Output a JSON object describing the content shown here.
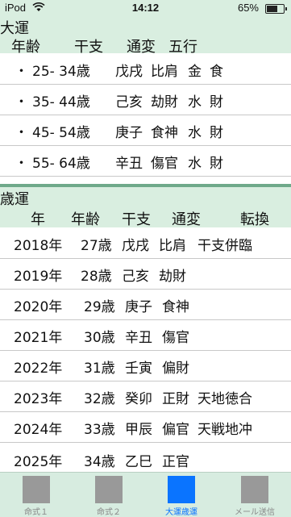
{
  "status": {
    "carrier": "iPod",
    "time": "14:12",
    "battery": "65%"
  },
  "daiun": {
    "title": "大運",
    "headers": [
      "年齢",
      "干支",
      "通変",
      "五行"
    ],
    "rows": [
      {
        "bullet": "・",
        "age": "25- 34歳",
        "kanshi": "戊戌",
        "tsuhen": "比肩",
        "gogyo": "金",
        "extra": "食"
      },
      {
        "bullet": "・",
        "age": "35- 44歳",
        "kanshi": "己亥",
        "tsuhen": "劫財",
        "gogyo": "水",
        "extra": "財"
      },
      {
        "bullet": "・",
        "age": "45- 54歳",
        "kanshi": "庚子",
        "tsuhen": "食神",
        "gogyo": "水",
        "extra": "財"
      },
      {
        "bullet": "・",
        "age": "55- 64歳",
        "kanshi": "辛丑",
        "tsuhen": "傷官",
        "gogyo": "水",
        "extra": "財"
      }
    ]
  },
  "saiun": {
    "title": "歳運",
    "headers": [
      "年",
      "年齢",
      "干支",
      "通変",
      "転換"
    ],
    "rows": [
      {
        "year": "2018年",
        "age": "27歳",
        "kanshi": "戊戌",
        "tsuhen": "比肩",
        "tenkan": "干支併臨"
      },
      {
        "year": "2019年",
        "age": "28歳",
        "kanshi": "己亥",
        "tsuhen": "劫財",
        "tenkan": ""
      },
      {
        "year": "2020年",
        "age": "29歳",
        "kanshi": "庚子",
        "tsuhen": "食神",
        "tenkan": ""
      },
      {
        "year": "2021年",
        "age": "30歳",
        "kanshi": "辛丑",
        "tsuhen": "傷官",
        "tenkan": ""
      },
      {
        "year": "2022年",
        "age": "31歳",
        "kanshi": "壬寅",
        "tsuhen": "偏財",
        "tenkan": ""
      },
      {
        "year": "2023年",
        "age": "32歳",
        "kanshi": "癸卯",
        "tsuhen": "正財",
        "tenkan": "天地徳合"
      },
      {
        "year": "2024年",
        "age": "33歳",
        "kanshi": "甲辰",
        "tsuhen": "偏官",
        "tenkan": "天戦地冲"
      },
      {
        "year": "2025年",
        "age": "34歳",
        "kanshi": "乙巳",
        "tsuhen": "正官",
        "tenkan": ""
      }
    ]
  },
  "tabs": [
    {
      "label": "命式１",
      "active": false
    },
    {
      "label": "命式２",
      "active": false
    },
    {
      "label": "大運歳運",
      "active": true
    },
    {
      "label": "メール送信",
      "active": false
    }
  ],
  "colors": {
    "header_bg": "#d9eee0",
    "header_bar": "#6fa98a",
    "accent": "#0a74ff",
    "tab_inactive": "#999999"
  }
}
